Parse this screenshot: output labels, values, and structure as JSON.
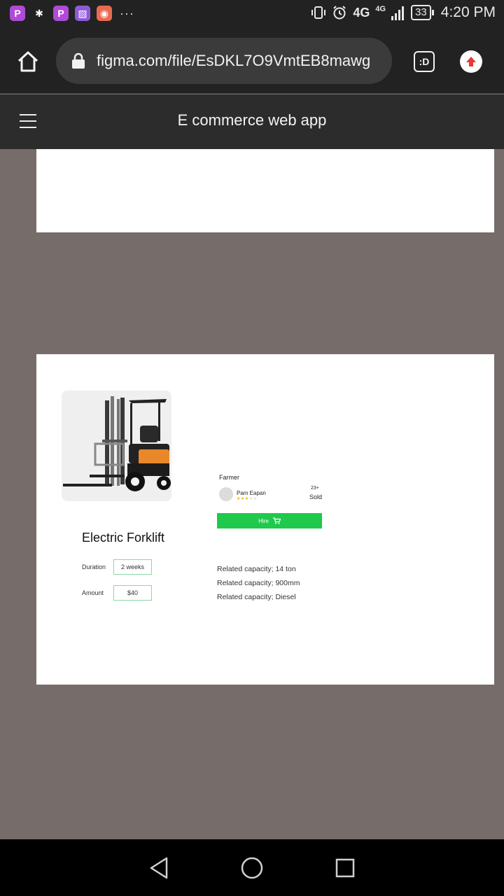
{
  "status_bar": {
    "app_icons": [
      {
        "icon": "picsart-icon",
        "glyph": "P",
        "color": "#b04bd6"
      },
      {
        "icon": "puzzle-app-icon",
        "glyph": "✱",
        "color": "#222222"
      },
      {
        "icon": "picsart-icon",
        "glyph": "P",
        "color": "#b04bd6"
      },
      {
        "icon": "gallery-app-icon",
        "glyph": "▨",
        "color": "#8e5bd6"
      },
      {
        "icon": "photo-app-icon",
        "glyph": "◉",
        "color": "#e86a50"
      }
    ],
    "more": "···",
    "network": "4G",
    "network_small": "4G",
    "battery": "33",
    "time": "4:20 PM"
  },
  "browser": {
    "url": "figma.com/file/EsDKL7O9VmtEB8mawg",
    "tabs_label": ":D"
  },
  "figma": {
    "title": "E commerce web app"
  },
  "product": {
    "name": "Electric Forklift",
    "duration_label": "Duration",
    "duration_value": "2 weeks",
    "amount_label": "Amount",
    "amount_value": "$40",
    "seller_role": "Farmer",
    "seller_name": "Pam Eapan",
    "rating": 3,
    "rating_max": 5,
    "sold_count": "23+",
    "sold_label": "Sold",
    "hire_label": "Hire",
    "specs": [
      "Related capacity;  14 ton",
      "Related capacity; 900mm",
      "Related capacity; Diesel"
    ],
    "colors": {
      "accent": "#1ec94c",
      "star": "#f4b400"
    }
  }
}
